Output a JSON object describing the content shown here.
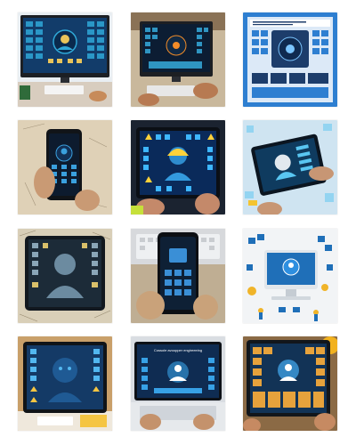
{
  "gallery": {
    "tiles": [
      {
        "subject": "desktop-monitor",
        "palette": [
          "#123c6a",
          "#2fa8d8",
          "#e9c45a"
        ]
      },
      {
        "subject": "desktop-monitor",
        "palette": [
          "#0c1d33",
          "#f28c28",
          "#38b4e6"
        ]
      },
      {
        "subject": "poster",
        "palette": [
          "#2e7fd1",
          "#ffffff",
          "#1d3d6b"
        ]
      },
      {
        "subject": "smartphone",
        "palette": [
          "#0d1b2e",
          "#3aa0de",
          "#e8c07a"
        ]
      },
      {
        "subject": "tablet",
        "palette": [
          "#0a2a5a",
          "#3db6ff",
          "#ffd23a"
        ]
      },
      {
        "subject": "tablet",
        "palette": [
          "#0f3b5f",
          "#59c6f2",
          "#e2e8ee"
        ]
      },
      {
        "subject": "tablet",
        "palette": [
          "#1c2b38",
          "#6c8ba0",
          "#d9c06a"
        ]
      },
      {
        "subject": "smartphone",
        "palette": [
          "#0e2035",
          "#3a8fd6",
          "#c9a27a"
        ]
      },
      {
        "subject": "desktop-monitor",
        "palette": [
          "#f2f4f6",
          "#1f6fb8",
          "#f0b429"
        ]
      },
      {
        "subject": "tablet",
        "palette": [
          "#143a66",
          "#52b7f0",
          "#f5c542"
        ]
      },
      {
        "subject": "laptop",
        "palette": [
          "#0f2c52",
          "#37a1e6",
          "#ffffff"
        ]
      },
      {
        "subject": "tablet",
        "palette": [
          "#123356",
          "#3f9de0",
          "#e6a23c"
        ]
      }
    ],
    "tile_texts": {
      "tile11": "Cossole avoopper engireeeing"
    }
  }
}
